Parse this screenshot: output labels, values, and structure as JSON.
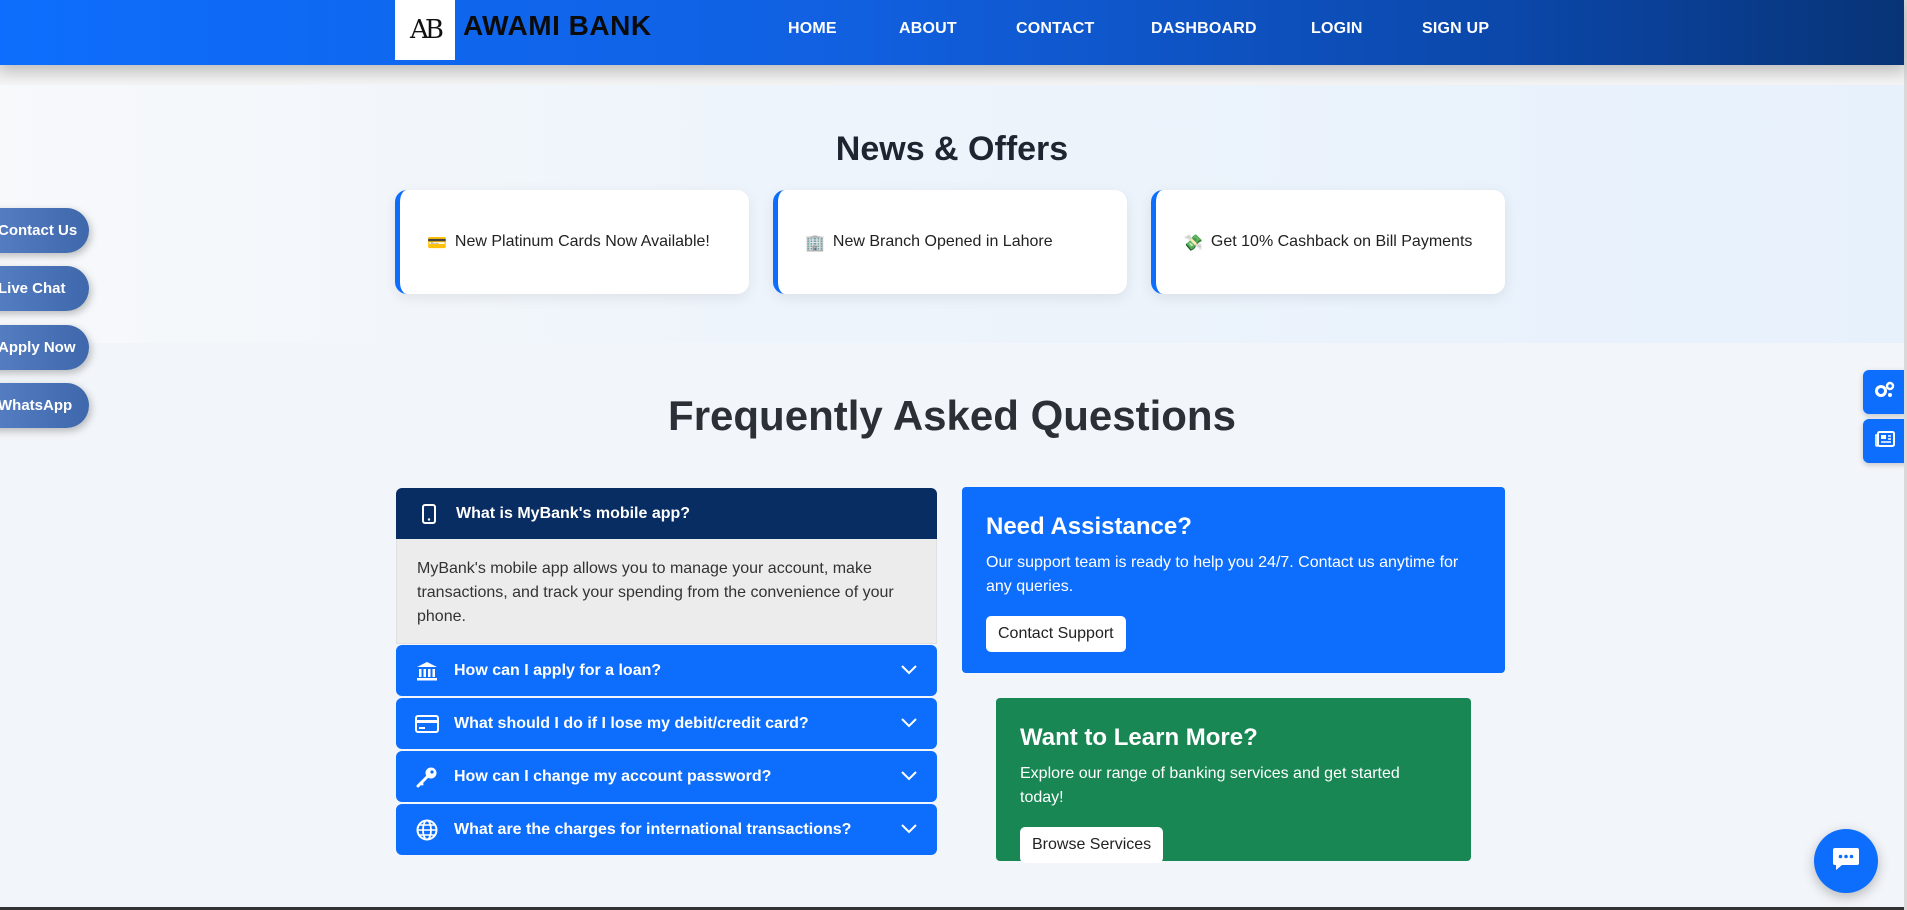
{
  "navbar": {
    "logo_text": "AB",
    "brand": "AWAMI BANK",
    "links": [
      {
        "label": "HOME"
      },
      {
        "label": "ABOUT"
      },
      {
        "label": "CONTACT"
      },
      {
        "label": "DASHBOARD"
      },
      {
        "label": "LOGIN"
      },
      {
        "label": "SIGN UP"
      }
    ]
  },
  "news": {
    "title": "News & Offers",
    "cards": [
      {
        "icon": "💳",
        "icon_name": "credit-card-icon",
        "text": "New Platinum Cards Now Available!"
      },
      {
        "icon": "🏢",
        "icon_name": "building-icon",
        "text": "New Branch Opened in Lahore"
      },
      {
        "icon": "💸",
        "icon_name": "money-icon",
        "text": "Get 10% Cashback on Bill Payments"
      }
    ]
  },
  "faq": {
    "title": "Frequently Asked Questions",
    "open_item": {
      "question": "What is MyBank's mobile app?",
      "answer": "MyBank's mobile app allows you to manage your account, make transactions, and track your spending from the convenience of your phone."
    },
    "items": [
      {
        "question": "How can I apply for a loan?",
        "icon_name": "bank-icon"
      },
      {
        "question": "What should I do if I lose my debit/credit card?",
        "icon_name": "credit-card-icon"
      },
      {
        "question": "How can I change my account password?",
        "icon_name": "key-icon"
      },
      {
        "question": "What are the charges for international transactions?",
        "icon_name": "globe-icon"
      }
    ]
  },
  "assist": {
    "title": "Need Assistance?",
    "text": "Our support team is ready to help you 24/7. Contact us anytime for any queries.",
    "button": "Contact Support"
  },
  "learn": {
    "title": "Want to Learn More?",
    "text": "Explore our range of banking services and get started today!",
    "button": "Browse Services"
  },
  "floating": [
    {
      "label": "Contact Us"
    },
    {
      "label": "Live Chat"
    },
    {
      "label": "Apply Now"
    },
    {
      "label": "WhatsApp"
    }
  ],
  "colors": {
    "primary": "#0d6efd",
    "navy": "#082d63",
    "green": "#198754"
  }
}
